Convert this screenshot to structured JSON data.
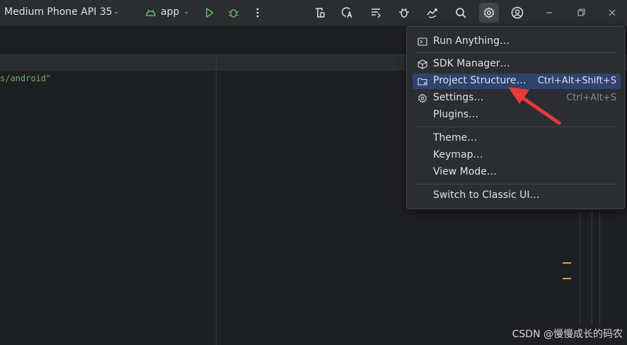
{
  "toolbar": {
    "device_label": "Medium Phone API 35",
    "run_config_label": "app",
    "icons": [
      "run-icon",
      "debug-icon",
      "more-icon",
      "device-manager-icon",
      "translate-icon",
      "logcat-icon",
      "bug-icon",
      "sync-icon",
      "search-icon",
      "settings-icon",
      "account-icon",
      "minimize-icon",
      "restore-icon",
      "close-icon"
    ]
  },
  "editor": {
    "code_fragment": "s/android\""
  },
  "menu": {
    "items": [
      {
        "label": "Run Anything…",
        "shortcut": "",
        "icon": "run-anything-icon"
      },
      {
        "label": "SDK Manager…",
        "shortcut": "",
        "icon": "sdk-manager-icon"
      },
      {
        "label": "Project Structure…",
        "shortcut": "Ctrl+Alt+Shift+S",
        "icon": "project-structure-icon",
        "selected": true
      },
      {
        "label": "Settings…",
        "shortcut": "Ctrl+Alt+S",
        "icon": "settings-icon"
      },
      {
        "label": "Plugins…",
        "shortcut": "",
        "icon": ""
      },
      {
        "label": "Theme…",
        "shortcut": "",
        "icon": ""
      },
      {
        "label": "Keymap…",
        "shortcut": "",
        "icon": ""
      },
      {
        "label": "View Mode…",
        "shortcut": "",
        "icon": ""
      },
      {
        "label": "Switch to Classic UI…",
        "shortcut": "",
        "icon": ""
      }
    ]
  },
  "watermark": "CSDN @慢慢成长的码农",
  "colors": {
    "accent_selection": "#2e436e",
    "arrow": "#e83a3a",
    "run_green": "#5fb865"
  }
}
